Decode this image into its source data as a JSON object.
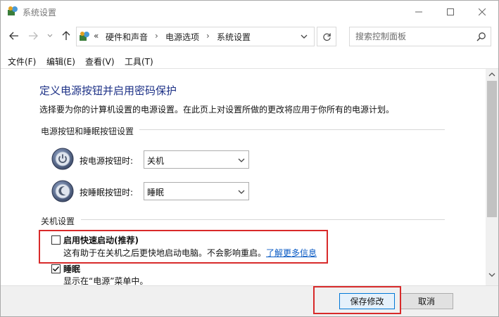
{
  "window": {
    "title": "系统设置"
  },
  "nav": {
    "breadcrumb_prefix": "«",
    "breadcrumbs": [
      "硬件和声音",
      "电源选项",
      "系统设置"
    ],
    "separator": "›",
    "search_placeholder": "搜索控制面板"
  },
  "menu": {
    "items": [
      "文件(F)",
      "编辑(E)",
      "查看(V)",
      "工具(T)"
    ]
  },
  "main": {
    "title": "定义电源按钮并启用密码保护",
    "description": "选择要为你的计算机设置的电源设置。在此页上对设置所做的更改将应用于你所有的电源计划。",
    "power_section": {
      "header": "电源按钮和睡眠按钮设置",
      "power_button_label": "按电源按钮时:",
      "power_button_value": "关机",
      "sleep_button_label": "按睡眠按钮时:",
      "sleep_button_value": "睡眠"
    },
    "shutdown_section": {
      "header": "关机设置",
      "fast_startup_label": "启用快速启动(推荐)",
      "fast_startup_checked": false,
      "fast_startup_desc": "这有助于在关机之后更快地启动电脑。不会影响重启。",
      "learn_more": "了解更多信息",
      "sleep_label": "睡眠",
      "sleep_checked": true,
      "sleep_desc": "显示在“电源”菜单中。"
    }
  },
  "footer": {
    "save_label": "保存修改",
    "cancel_label": "取消"
  },
  "colors": {
    "title_blue": "#1e3287",
    "link_blue": "#0a5bc4",
    "highlight_red": "#d82a2a",
    "primary_border": "#0078d7"
  }
}
